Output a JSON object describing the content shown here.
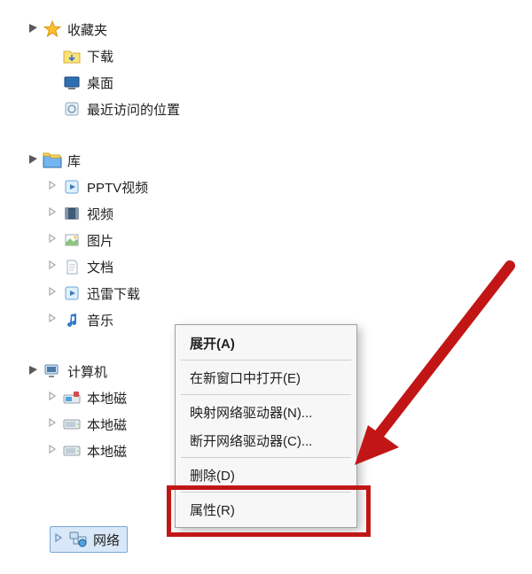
{
  "tree": {
    "favorites": {
      "label": "收藏夹",
      "children": [
        {
          "label": "下载"
        },
        {
          "label": "桌面"
        },
        {
          "label": "最近访问的位置"
        }
      ]
    },
    "libraries": {
      "label": "库",
      "children": [
        {
          "label": "PPTV视频"
        },
        {
          "label": "视频"
        },
        {
          "label": "图片"
        },
        {
          "label": "文档"
        },
        {
          "label": "迅雷下载"
        },
        {
          "label": "音乐"
        }
      ]
    },
    "computer": {
      "label": "计算机",
      "children": [
        {
          "label": "本地磁"
        },
        {
          "label": "本地磁"
        },
        {
          "label": "本地磁"
        }
      ]
    },
    "network": {
      "label": "网络"
    }
  },
  "context_menu": {
    "items": [
      "展开(A)",
      "在新窗口中打开(E)",
      "映射网络驱动器(N)...",
      "断开网络驱动器(C)...",
      "删除(D)",
      "属性(R)"
    ]
  }
}
